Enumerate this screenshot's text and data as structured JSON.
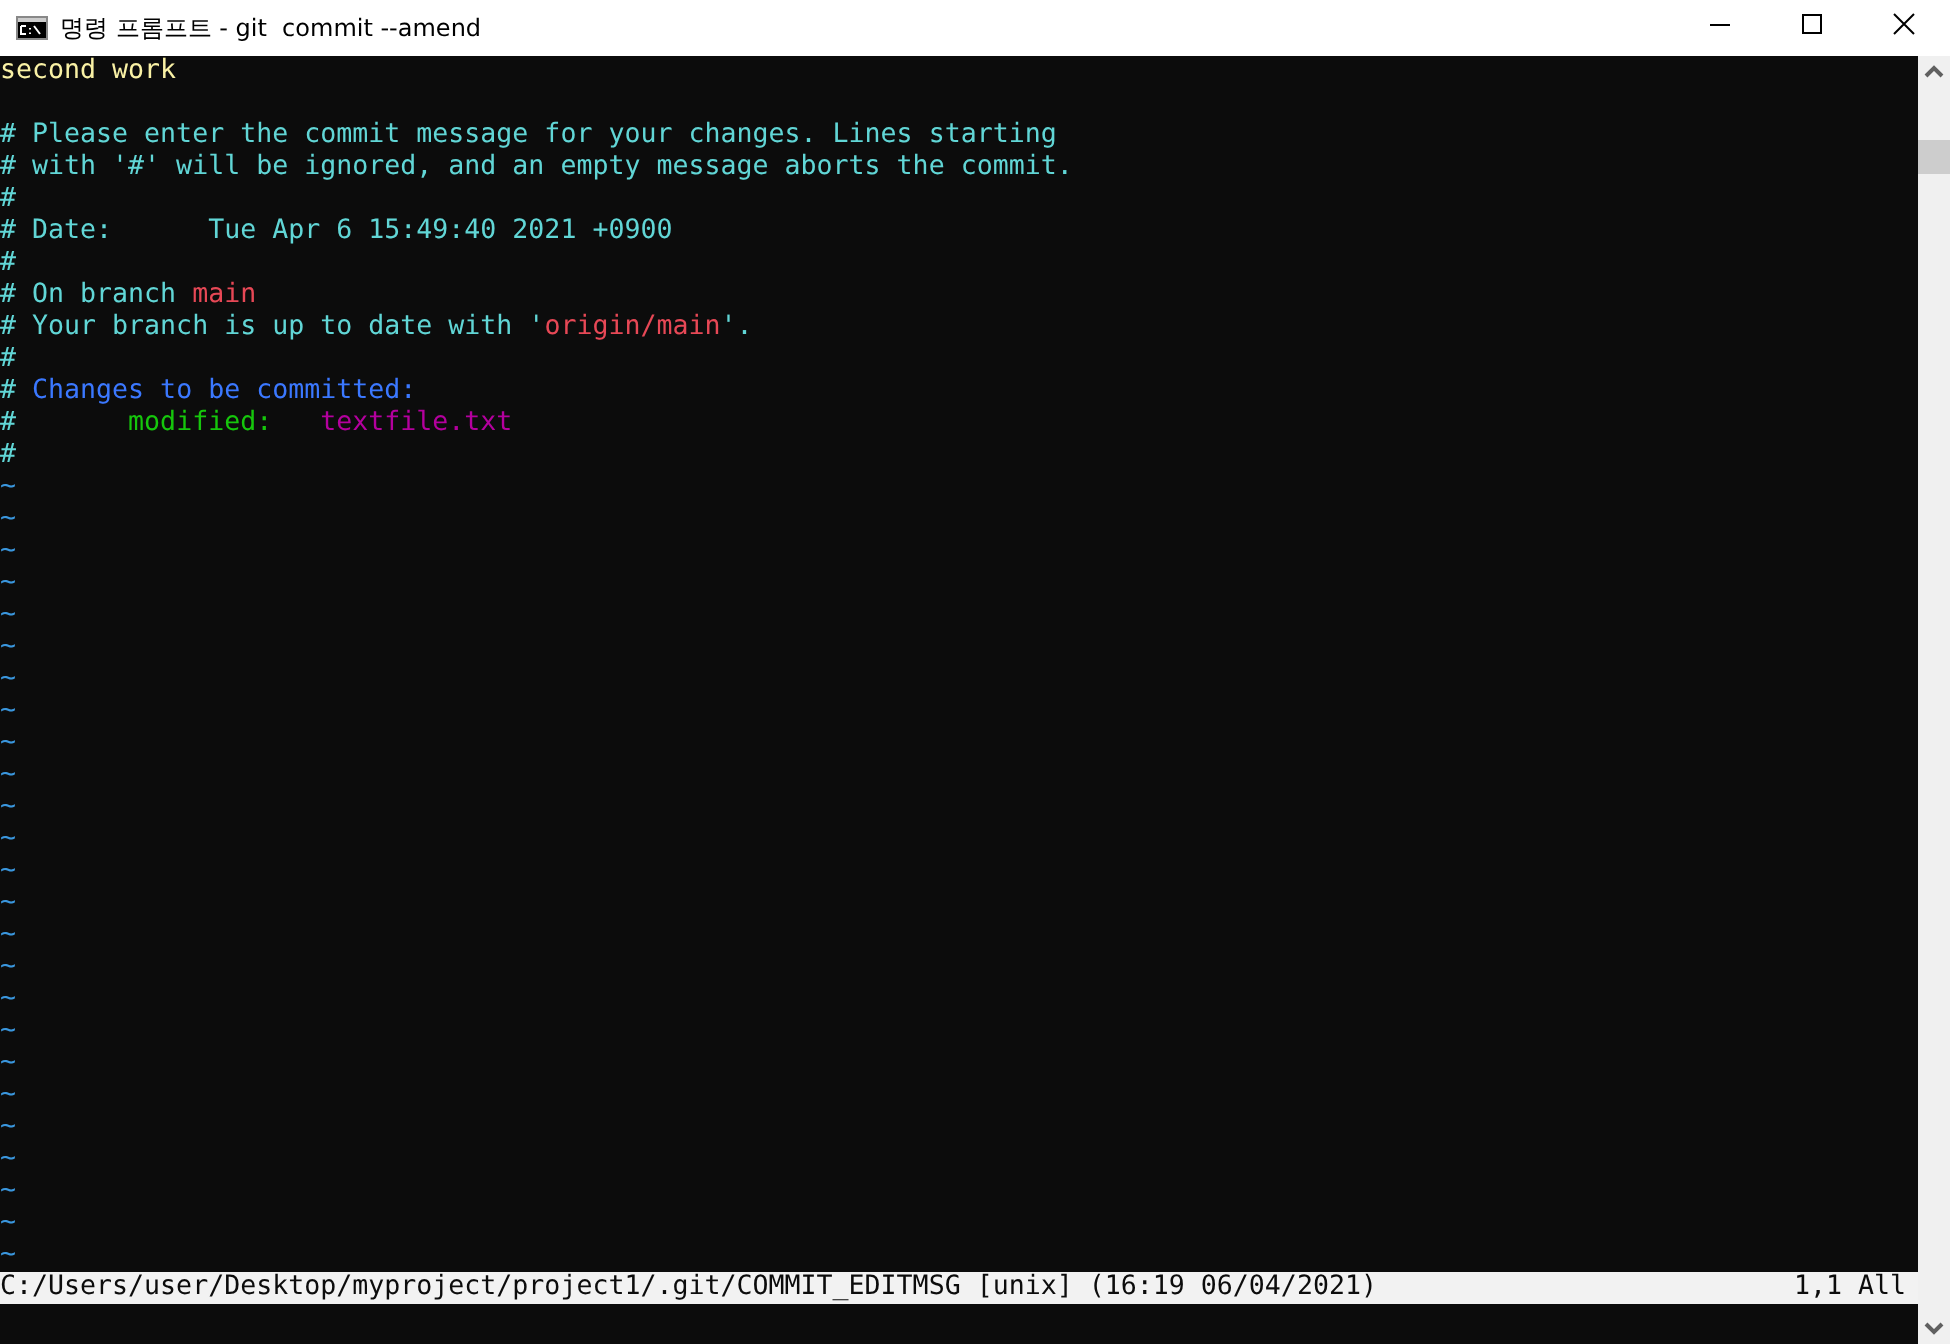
{
  "window": {
    "title": "명령 프롬프트 - git  commit --amend"
  },
  "lines": [
    {
      "kind": "text",
      "segments": [
        {
          "text": "second work",
          "color": "#f9f1a5"
        }
      ]
    },
    {
      "kind": "blank"
    },
    {
      "kind": "text",
      "segments": [
        {
          "text": "# Please enter the commit message for your changes. Lines starting",
          "color": "#61d6d6"
        }
      ]
    },
    {
      "kind": "text",
      "segments": [
        {
          "text": "# with '#' will be ignored, and an empty message aborts the commit.",
          "color": "#61d6d6"
        }
      ]
    },
    {
      "kind": "text",
      "segments": [
        {
          "text": "#",
          "color": "#61d6d6"
        }
      ]
    },
    {
      "kind": "text",
      "segments": [
        {
          "text": "# Date:      Tue Apr 6 15:49:40 2021 +0900",
          "color": "#61d6d6"
        }
      ]
    },
    {
      "kind": "text",
      "segments": [
        {
          "text": "#",
          "color": "#61d6d6"
        }
      ]
    },
    {
      "kind": "text",
      "segments": [
        {
          "text": "# On branch ",
          "color": "#61d6d6"
        },
        {
          "text": "main",
          "color": "#e74856"
        }
      ]
    },
    {
      "kind": "text",
      "segments": [
        {
          "text": "# Your branch is up to date with '",
          "color": "#61d6d6"
        },
        {
          "text": "origin/main",
          "color": "#e74856"
        },
        {
          "text": "'.",
          "color": "#61d6d6"
        }
      ]
    },
    {
      "kind": "text",
      "segments": [
        {
          "text": "#",
          "color": "#61d6d6"
        }
      ]
    },
    {
      "kind": "text",
      "segments": [
        {
          "text": "# ",
          "color": "#61d6d6"
        },
        {
          "text": "Changes to be committed:",
          "color": "#3b78ff"
        }
      ]
    },
    {
      "kind": "text",
      "segments": [
        {
          "text": "#       ",
          "color": "#61d6d6"
        },
        {
          "text": "modified:   ",
          "color": "#16c60c"
        },
        {
          "text": "textfile.txt",
          "color": "#b4009e"
        }
      ]
    },
    {
      "kind": "text",
      "segments": [
        {
          "text": "#",
          "color": "#61d6d6"
        }
      ]
    },
    {
      "kind": "tilde",
      "text": "~"
    },
    {
      "kind": "tilde",
      "text": "~"
    },
    {
      "kind": "tilde",
      "text": "~"
    },
    {
      "kind": "tilde",
      "text": "~"
    },
    {
      "kind": "tilde",
      "text": "~"
    },
    {
      "kind": "tilde",
      "text": "~"
    },
    {
      "kind": "tilde",
      "text": "~"
    },
    {
      "kind": "tilde",
      "text": "~"
    },
    {
      "kind": "tilde",
      "text": "~"
    },
    {
      "kind": "tilde",
      "text": "~"
    },
    {
      "kind": "tilde",
      "text": "~"
    },
    {
      "kind": "tilde",
      "text": "~"
    },
    {
      "kind": "tilde",
      "text": "~"
    },
    {
      "kind": "tilde",
      "text": "~"
    },
    {
      "kind": "tilde",
      "text": "~"
    },
    {
      "kind": "tilde",
      "text": "~"
    },
    {
      "kind": "tilde",
      "text": "~"
    },
    {
      "kind": "tilde",
      "text": "~"
    },
    {
      "kind": "tilde",
      "text": "~"
    },
    {
      "kind": "tilde",
      "text": "~"
    },
    {
      "kind": "tilde",
      "text": "~"
    },
    {
      "kind": "tilde",
      "text": "~"
    },
    {
      "kind": "tilde",
      "text": "~"
    },
    {
      "kind": "tilde",
      "text": "~"
    },
    {
      "kind": "tilde",
      "text": "~"
    }
  ],
  "status_bar": {
    "file_info": "C:/Users/user/Desktop/myproject/project1/.git/COMMIT_EDITMSG [unix] (16:19 06/04/2021)",
    "position": "1,1 All"
  }
}
